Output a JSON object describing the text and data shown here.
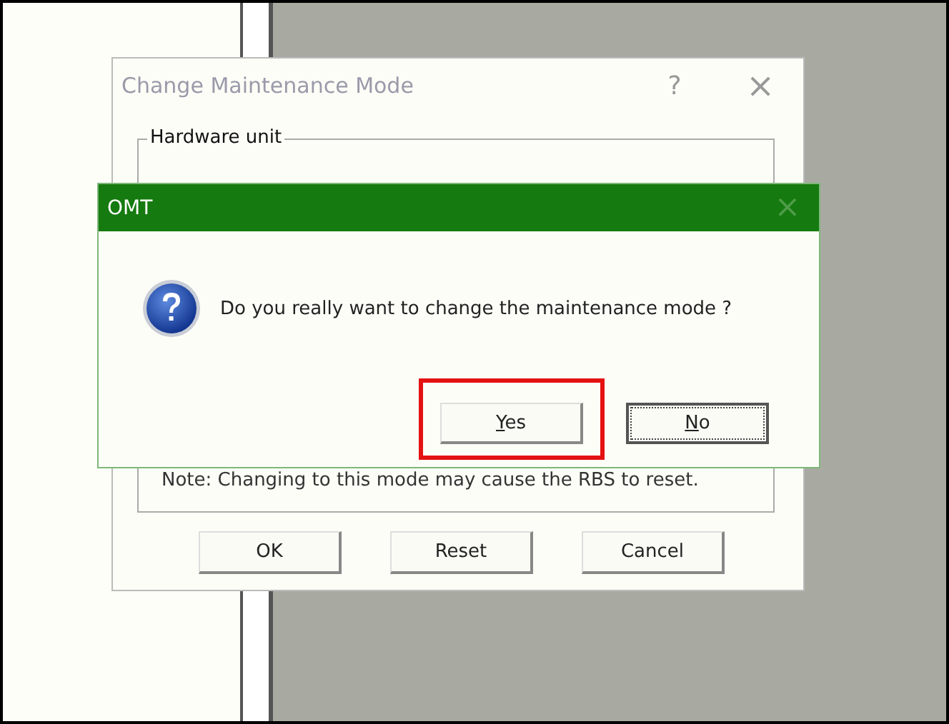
{
  "back_dialog": {
    "title": "Change Maintenance Mode",
    "help": "?",
    "close": "×",
    "group_title": "Hardware unit",
    "note": "Note: Changing to this mode may cause the RBS to reset.",
    "buttons": [
      {
        "label": "OK"
      },
      {
        "label": "Reset"
      },
      {
        "label": "Cancel"
      }
    ]
  },
  "message_box": {
    "title": "OMT",
    "close": "×",
    "message": "Do you really want to change the maintenance mode ?",
    "buttons": [
      {
        "label": "Yes",
        "underline_first": true,
        "highlighted": true,
        "default": false
      },
      {
        "label": "No",
        "underline_first": true,
        "highlighted": false,
        "default": true
      }
    ]
  }
}
